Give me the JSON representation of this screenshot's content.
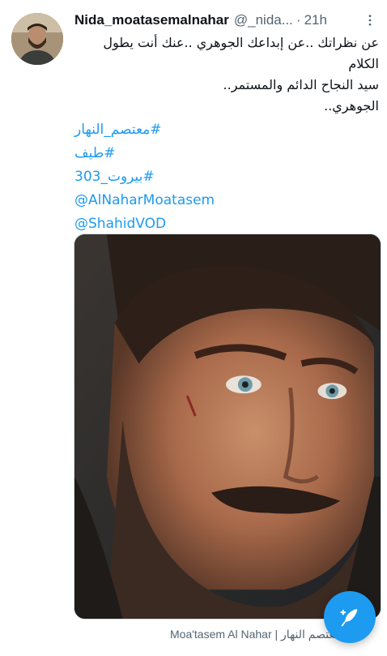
{
  "tweet": {
    "display_name": "Nida_moatasemalnahar",
    "handle": "@_nida...",
    "separator": "·",
    "time": "21h",
    "body_lines": [
      "عن نظراتك ..عن إبداعك الجوهري ..عنك أنت يطول الكلام",
      "سيد النجاح الدائم والمستمر..",
      "الجوهري.."
    ],
    "hashtags": [
      "#معتصم_النهار",
      "#طيف",
      "#بيروت_303",
      "@AlNaharMoatasem",
      "@ShahidVOD"
    ],
    "media_caption": "Moa'tasem Al Nahar | معتصم النهار"
  },
  "icons": {
    "more": "more-dots-icon",
    "compose": "compose-feather-icon"
  },
  "colors": {
    "link": "#1d9bf0",
    "secondary": "#536471",
    "fab": "#1d9bf0"
  }
}
